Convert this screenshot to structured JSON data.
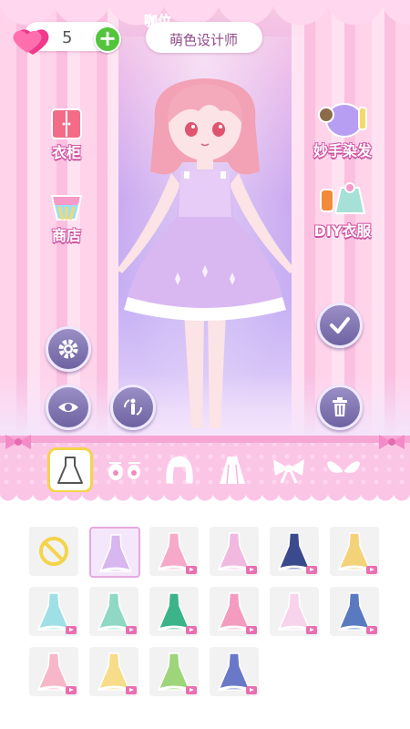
{
  "header": {
    "hearts_count": "5",
    "title_tag": "咖位",
    "title": "萌色设计师"
  },
  "side_menu": {
    "wardrobe_label": "衣柜",
    "shop_label": "商店",
    "hair_dye_label": "妙手染发",
    "diy_clothes_label": "DIY衣服"
  },
  "colors": {
    "accent_pink": "#ff6fb0",
    "button_purple": "#7b70ad",
    "plus_green": "#54c43d",
    "tray_pink": "#fbc5e5",
    "active_tab_border": "#f4d44a"
  },
  "categories": [
    {
      "name": "dress",
      "icon": "dress-icon",
      "active": true
    },
    {
      "name": "eyes",
      "icon": "eyes-icon",
      "active": false
    },
    {
      "name": "hair",
      "icon": "hair-icon",
      "active": false
    },
    {
      "name": "cape",
      "icon": "cape-icon",
      "active": false
    },
    {
      "name": "bow",
      "icon": "bow-icon",
      "active": false
    },
    {
      "name": "wings",
      "icon": "wings-icon",
      "active": false
    }
  ],
  "items": [
    {
      "icon": "none-icon",
      "color": "#f4d44a",
      "video": false
    },
    {
      "icon": "lavender-dress-icon",
      "color": "#d8b6f0",
      "video": false,
      "selected": true
    },
    {
      "icon": "pink-coat-dress-icon",
      "color": "#f6a9c8",
      "video": true
    },
    {
      "icon": "pink-fairy-dress-icon",
      "color": "#f1b8e0",
      "video": true
    },
    {
      "icon": "navy-uniform-icon",
      "color": "#3a4a8c",
      "video": true
    },
    {
      "icon": "yellow-uniform-icon",
      "color": "#f3d27a",
      "video": true
    },
    {
      "icon": "aqua-lolita-dress-icon",
      "color": "#9fe0e6",
      "video": true
    },
    {
      "icon": "mint-sailor-dress-icon",
      "color": "#8fd8c4",
      "video": true
    },
    {
      "icon": "green-hanfu-icon",
      "color": "#3bb48a",
      "video": true
    },
    {
      "icon": "pink-floral-dress-icon",
      "color": "#f49bc0",
      "video": true
    },
    {
      "icon": "white-pink-gown-icon",
      "color": "#f8d4ec",
      "video": true
    },
    {
      "icon": "blue-maid-dress-icon",
      "color": "#5a7ac0",
      "video": true
    },
    {
      "icon": "pink-hanfu-icon",
      "color": "#f7b7c9",
      "video": true
    },
    {
      "icon": "yellow-ball-gown-icon",
      "color": "#f7dd8a",
      "video": true
    },
    {
      "icon": "green-fairy-gown-icon",
      "color": "#9ed47a",
      "video": true
    },
    {
      "icon": "blue-star-gown-icon",
      "color": "#6a78c8",
      "video": true
    }
  ]
}
